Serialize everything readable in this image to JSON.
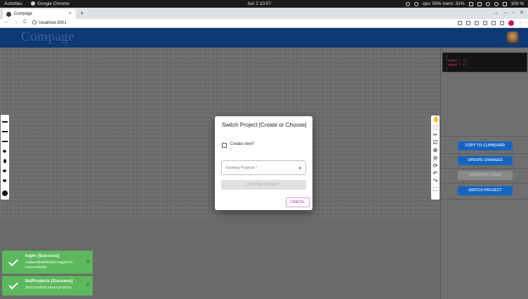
{
  "system_bar": {
    "activities": "Activities",
    "app_name": "Google Chrome",
    "clock": "Jun 2  10:07",
    "stats": "cpu: 05% mem: 31%",
    "battery": "100 %"
  },
  "browser": {
    "tab_title": "Compage",
    "tab_close": "×",
    "new_tab": "+",
    "url": "localhost:3001",
    "nav": {
      "back": "←",
      "forward": "→",
      "reload": "C"
    },
    "window_controls": {
      "dropdown": "⌄",
      "minimize": "–",
      "maximize": "▫",
      "close": "✕"
    }
  },
  "app": {
    "logo": "Compage"
  },
  "right_panel": {
    "json_lines": [
      "{",
      "  \"nodes\": {},",
      "  \"edges\": {}",
      "}"
    ],
    "buttons": {
      "copy": "COPY TO CLIPBOARD",
      "update": "UPDATE CHANGES",
      "generate": "GENERATE CODE",
      "switch": "SWITCH PROJECT"
    }
  },
  "dialog": {
    "title": "Switch Project [Create or Choose]",
    "create_new_label": "Create new?",
    "create_new_checked": false,
    "select_label": "Existing Projects *",
    "choose_button": "CHOOSE PROJECT",
    "cancel_button": "CANCEL"
  },
  "toasts": [
    {
      "title": "login [Success]",
      "message": "mahendraintelops logged in successfully.",
      "close": "✕"
    },
    {
      "title": "listProjects [Success]",
      "message": "Successfully listed projects.",
      "close": "✕"
    }
  ],
  "right_tools": [
    "✋",
    "⬚",
    "✂",
    "☑",
    "⊕",
    "⊖",
    "⟳",
    "↶",
    "↷",
    "⛶"
  ]
}
